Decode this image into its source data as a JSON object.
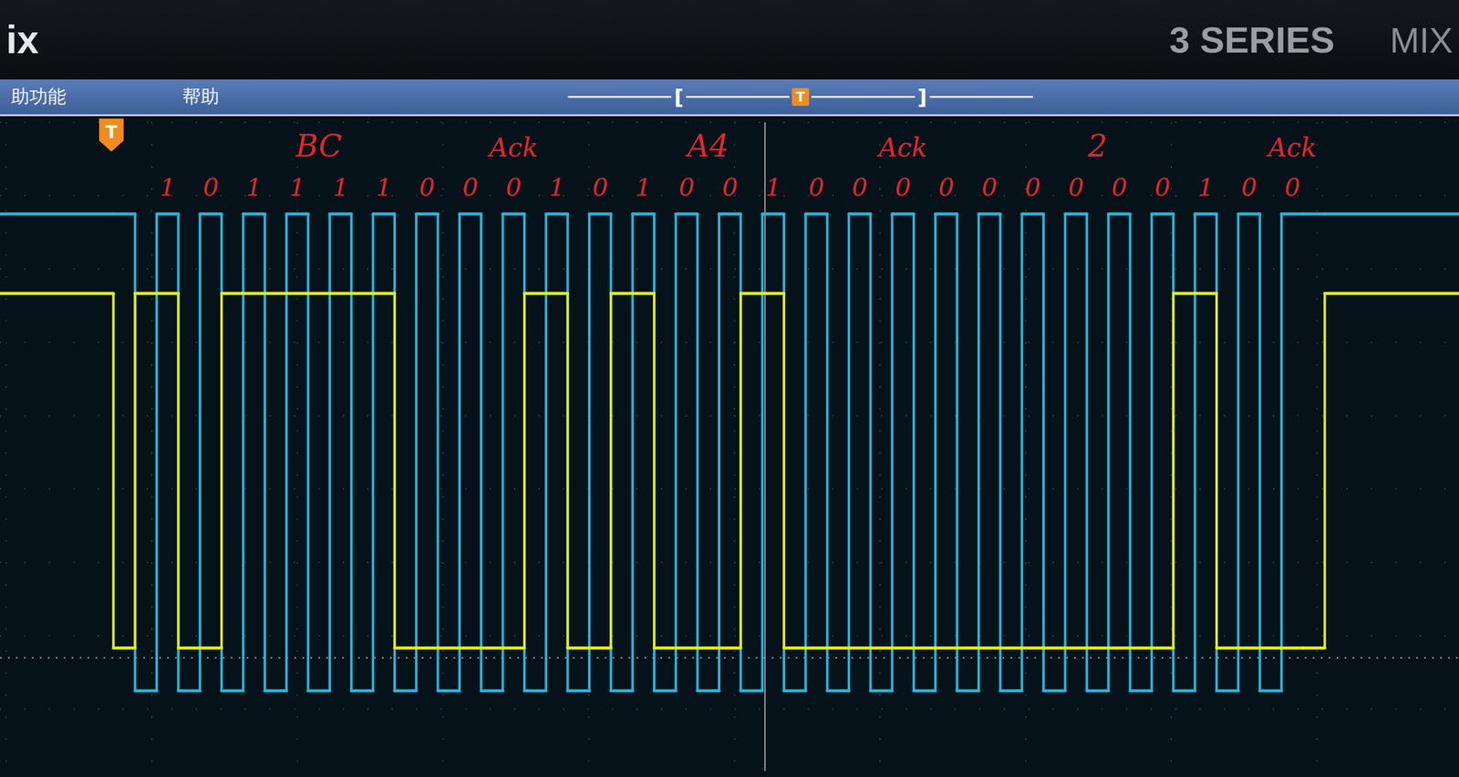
{
  "header": {
    "brand": "ix",
    "series": "3 SERIES",
    "model": "MIX"
  },
  "menu": [
    {
      "label": "助功能"
    },
    {
      "label": "帮助"
    }
  ],
  "position_bar": {
    "left": "[",
    "marker": "T",
    "right": "]"
  },
  "chart": {
    "trigger_marker": "T",
    "series": [
      {
        "color": "#22b8e0",
        "values": [
          3.3,
          3.3,
          0,
          3.3,
          0,
          3.3,
          0,
          3.3,
          0,
          3.3,
          0,
          3.3,
          0,
          3.3,
          0,
          3.3,
          0,
          3.3,
          0,
          3.3,
          0,
          3.3,
          0,
          3.3,
          0,
          3.3,
          0,
          3.3,
          0,
          3.3,
          0,
          3.3,
          0,
          3.3,
          0,
          3.3,
          0,
          3.3,
          0,
          3.3,
          0,
          3.3,
          0,
          3.3,
          0,
          3.3,
          0,
          3.3,
          0,
          3.3,
          0,
          3.3,
          0,
          3.3,
          0,
          3.3,
          3.3,
          3.3
        ]
      },
      {
        "color": "#e4ee1a",
        "values": [
          3.3,
          0,
          3.3,
          3.3,
          0,
          0,
          3.3,
          3.3,
          3.3,
          3.3,
          3.3,
          3.3,
          3.3,
          3.3,
          0,
          0,
          0,
          0,
          0,
          0,
          3.3,
          3.3,
          0,
          0,
          3.3,
          3.3,
          0,
          0,
          0,
          0,
          3.3,
          3.3,
          0,
          0,
          0,
          0,
          0,
          0,
          0,
          0,
          0,
          0,
          0,
          0,
          0,
          0,
          0,
          0,
          0,
          0,
          3.3,
          3.3,
          0,
          0,
          0,
          0,
          0,
          3.3
        ]
      }
    ]
  },
  "annotations": {
    "bytes": [
      {
        "label": "BC",
        "bits": [
          "1",
          "0",
          "1",
          "1",
          "1",
          "1",
          "0",
          "0"
        ],
        "ack_label": "Ack",
        "ack_bit": "0"
      },
      {
        "label": "A4",
        "bits": [
          "1",
          "0",
          "1",
          "0",
          "0",
          "1",
          "0",
          "0"
        ],
        "ack_label": "Ack",
        "ack_bit": "0"
      },
      {
        "label": "2",
        "bits": [
          "0",
          "0",
          "0",
          "0",
          "0",
          "0",
          "1",
          "0"
        ],
        "ack_label": "Ack",
        "ack_bit": "0"
      }
    ]
  }
}
